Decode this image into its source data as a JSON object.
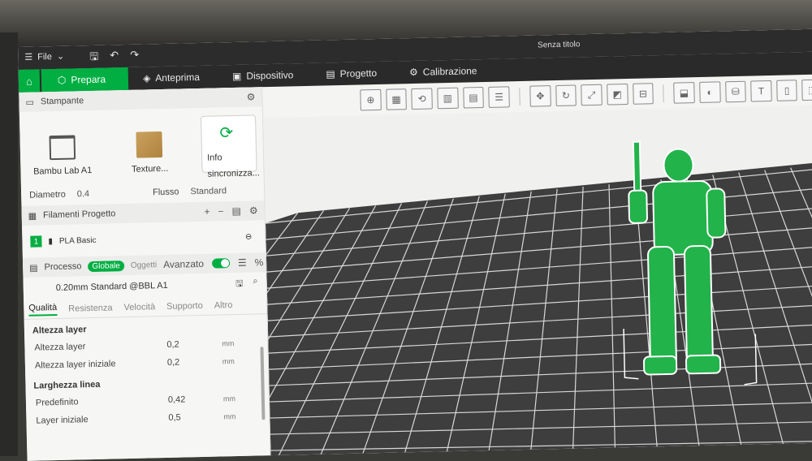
{
  "window": {
    "title": "Senza titolo"
  },
  "menu": {
    "file_label": "File"
  },
  "tabs": [
    {
      "label": "Prepara",
      "icon": "cube-icon"
    },
    {
      "label": "Anteprima",
      "icon": "layers-icon"
    },
    {
      "label": "Dispositivo",
      "icon": "device-icon"
    },
    {
      "label": "Progetto",
      "icon": "project-icon"
    },
    {
      "label": "Calibrazione",
      "icon": "calibration-icon"
    }
  ],
  "printer": {
    "section_title": "Stampante",
    "printer_name": "Bambu Lab A1",
    "plate_label": "Texture...",
    "sync_label_1": "Info",
    "sync_label_2": "sincronizza...",
    "diameter_label": "Diametro",
    "diameter_value": "0.4",
    "flow_label": "Flusso",
    "flow_value": "Standard"
  },
  "filaments": {
    "section_title": "Filamenti Progetto",
    "items": [
      {
        "number": "1",
        "name": "PLA Basic",
        "color": "#00ae42"
      }
    ]
  },
  "process": {
    "section_title": "Processo",
    "global_label": "Globale",
    "objects_label": "Oggetti",
    "advanced_label": "Avanzato",
    "preset": "0.20mm Standard @BBL A1",
    "subtabs": [
      "Qualità",
      "Resistenza",
      "Velocità",
      "Supporto",
      "Altro"
    ],
    "groups": [
      {
        "title": "Altezza layer",
        "params": [
          {
            "label": "Altezza layer",
            "value": "0,2",
            "unit": "mm"
          },
          {
            "label": "Altezza layer iniziale",
            "value": "0,2",
            "unit": "mm"
          }
        ]
      },
      {
        "title": "Larghezza linea",
        "params": [
          {
            "label": "Predefinito",
            "value": "0,42",
            "unit": "mm"
          },
          {
            "label": "Layer iniziale",
            "value": "0,5",
            "unit": "mm"
          }
        ]
      }
    ]
  },
  "colors": {
    "accent": "#00ae42",
    "bed": "#3d3d3d",
    "model": "#22b34a"
  }
}
